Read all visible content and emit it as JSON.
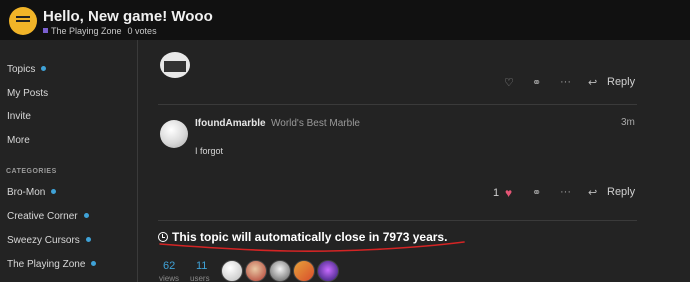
{
  "header": {
    "title": "Hello, New game! Wooo",
    "category": "The Playing Zone",
    "votes": "0 votes",
    "logo_icon": "speech-bubble-icon"
  },
  "sidebar": {
    "items": [
      {
        "label": "Topics",
        "unread_dot": true
      },
      {
        "label": "My Posts",
        "unread_dot": false
      },
      {
        "label": "Invite",
        "unread_dot": false
      },
      {
        "label": "More",
        "unread_dot": false
      }
    ],
    "categories_heading": "CATEGORIES",
    "categories": [
      {
        "label": "Bro-Mon",
        "unread_dot": true
      },
      {
        "label": "Creative Corner",
        "unread_dot": true
      },
      {
        "label": "Sweezy Cursors",
        "unread_dot": true
      },
      {
        "label": "The Playing Zone",
        "unread_dot": true
      }
    ]
  },
  "top_post_actions": {
    "icons": [
      "heart-outline-icon",
      "link-icon",
      "ellipsis-icon",
      "reply-arrow-icon"
    ],
    "reply_label": "Reply"
  },
  "post": {
    "username": "IfoundAmarble",
    "user_title": "World's Best Marble",
    "date": "3m",
    "body": "I forgot",
    "like_count": "1",
    "reply_label": "Reply"
  },
  "topic_notice": "This topic will automatically close in 7973 years.",
  "stats": {
    "views_count": "62",
    "views_label": "views",
    "users_count": "11",
    "users_label": "users"
  },
  "colors": {
    "accent_blue": "#3fa2d7",
    "like_heart": "#e45575",
    "logo_yellow": "#f1b428",
    "annotation_red": "#d42424"
  }
}
